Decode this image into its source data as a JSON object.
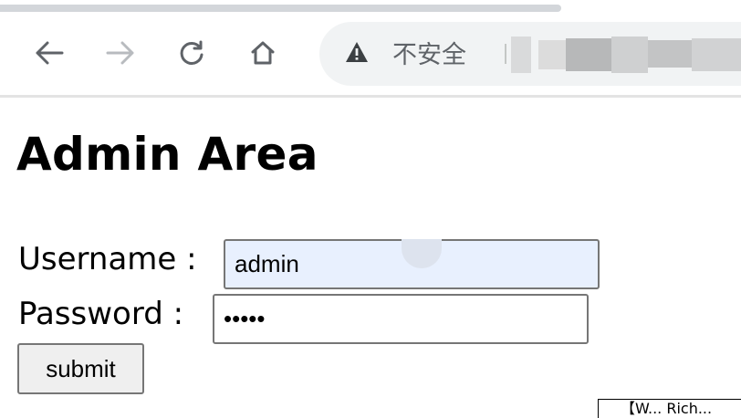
{
  "browser": {
    "nav": {
      "back_icon": "arrow-left-icon",
      "forward_icon": "arrow-right-icon",
      "reload_icon": "reload-icon",
      "home_icon": "home-icon"
    },
    "address_bar": {
      "security_icon": "warning-triangle-icon",
      "security_text": "不安全"
    }
  },
  "page": {
    "title": "Admin Area",
    "form": {
      "username_label": "Username :",
      "username_value": "admin",
      "password_label": "Password :",
      "password_value": "•••••",
      "submit_label": "submit"
    }
  },
  "overlay": {
    "corner_text": "【W... Rich..."
  },
  "colors": {
    "autofill_bg": "#e8f0fe",
    "omnibox_bg": "#f1f3f4",
    "button_bg": "#efefef",
    "icon_color": "#5f6368"
  }
}
